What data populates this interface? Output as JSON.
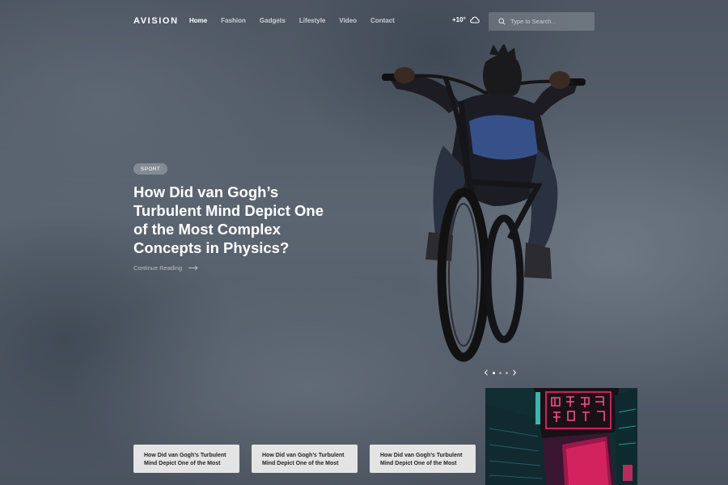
{
  "brand": {
    "logo": "AVISION"
  },
  "nav": [
    {
      "label": "Home",
      "active": true
    },
    {
      "label": "Fashion"
    },
    {
      "label": "Gadgets"
    },
    {
      "label": "Lifestyle"
    },
    {
      "label": "Video"
    },
    {
      "label": "Contact"
    }
  ],
  "weather": {
    "temp": "+10°",
    "icon": "cloud-icon"
  },
  "search": {
    "placeholder": "Type to Search...",
    "icon": "search-icon"
  },
  "hero": {
    "category": "SPORT",
    "title": "How Did van Gogh’s Turbulent Mind Depict One of the Most Complex Concepts in Physics?",
    "cta": "Continue Reading"
  },
  "slider": {
    "slides": 3,
    "active_index": 0
  },
  "cards": [
    {
      "title_line1": "How Did van Gogh’s Turbulent",
      "title_line2": "Mind Depict One of the Most"
    },
    {
      "title_line1": "How Did van Gogh’s Turbulent",
      "title_line2": "Mind Depict One of the Most"
    },
    {
      "title_line1": "How Did van Gogh’s Turbulent",
      "title_line2": "Mind Depict One of the Most"
    }
  ],
  "colors": {
    "card_bg": "#e4e4e4",
    "neon_pink": "#ff2d6f",
    "neon_cyan": "#3fe0d0"
  }
}
